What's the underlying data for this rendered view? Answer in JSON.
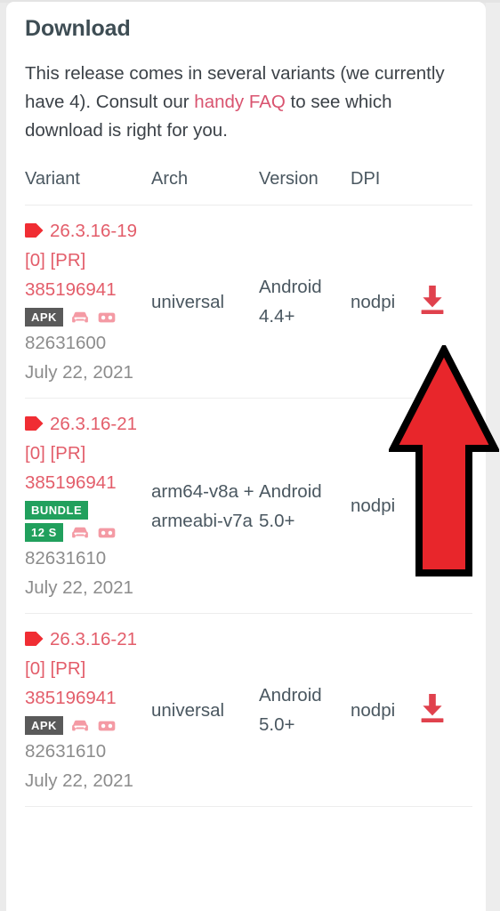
{
  "section": {
    "title": "Download",
    "intro_before": "This release comes in several variants (we currently have 4). Consult our ",
    "intro_link": "handy FAQ",
    "intro_after": " to see which download is right for you."
  },
  "table": {
    "headers": {
      "variant": "Variant",
      "arch": "Arch",
      "version": "Version",
      "dpi": "DPI",
      "download": ""
    },
    "rows": [
      {
        "tag_icon": "tag-icon",
        "variant": "26.3.16-19 [0] [PR] 385196941",
        "badges": [
          {
            "type": "apk",
            "label": "APK"
          }
        ],
        "feature_icons": [
          "car-icon",
          "vr-goggles-icon"
        ],
        "size": "82631600",
        "date": "July 22, 2021",
        "arch": "universal",
        "version": "Android 4.4+",
        "dpi": "nodpi",
        "download_icon": "download-icon",
        "has_download": true
      },
      {
        "tag_icon": "tag-icon",
        "variant": "26.3.16-21 [0] [PR] 385196941",
        "badges": [
          {
            "type": "bundle",
            "label": "BUNDLE"
          },
          {
            "type": "split",
            "label": "12 S"
          }
        ],
        "feature_icons": [
          "car-icon",
          "vr-goggles-icon"
        ],
        "size": "82631610",
        "date": "July 22, 2021",
        "arch": "arm64-v8a + armeabi-v7a",
        "version": "Android 5.0+",
        "dpi": "nodpi",
        "download_icon": "download-icon",
        "has_download": true
      },
      {
        "tag_icon": "tag-icon",
        "variant": "26.3.16-21 [0] [PR] 385196941",
        "badges": [
          {
            "type": "apk",
            "label": "APK"
          }
        ],
        "feature_icons": [
          "car-icon",
          "vr-goggles-icon"
        ],
        "size": "82631610",
        "date": "July 22, 2021",
        "arch": "universal",
        "version": "Android 5.0+",
        "dpi": "nodpi",
        "download_icon": "download-icon",
        "has_download": true
      }
    ]
  },
  "annotation": {
    "name": "red-arrow-pointing-to-download",
    "fill": "#e8262b",
    "stroke": "#000000"
  },
  "colors": {
    "variant_red": "#e35d6a",
    "link_red": "#d9536f",
    "badge_green": "#21a05d",
    "badge_gray": "#5a5a5a",
    "heading": "#3e4d54",
    "muted": "#8c8c8c",
    "download_red": "#e0414d"
  }
}
